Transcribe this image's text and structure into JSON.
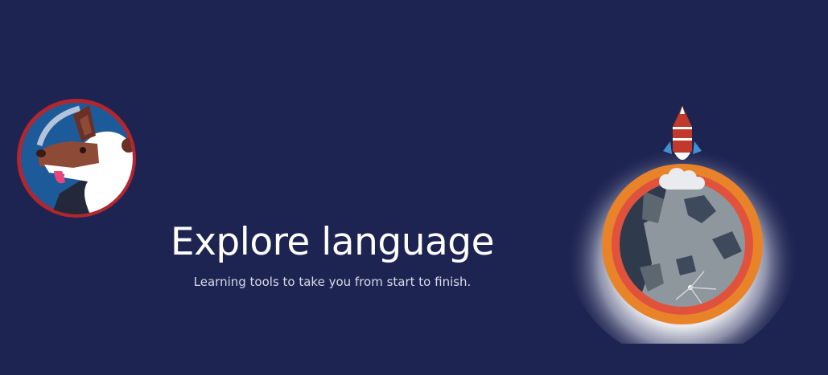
{
  "hero": {
    "title": "Explore language",
    "subtitle": "Learning tools to take you from start to finish."
  },
  "illustrations": {
    "left": "astronaut-dog-icon",
    "right": "rocket-moon-icon"
  },
  "colors": {
    "background": "#1e2452",
    "badge_ring_red": "#b3262e",
    "badge_fill_blue": "#1d5a9a",
    "moon_ring_orange": "#e8832a",
    "moon_ring_red": "#e0523c",
    "moon_gray": "#8f979e",
    "rocket_red": "#c0392b"
  }
}
